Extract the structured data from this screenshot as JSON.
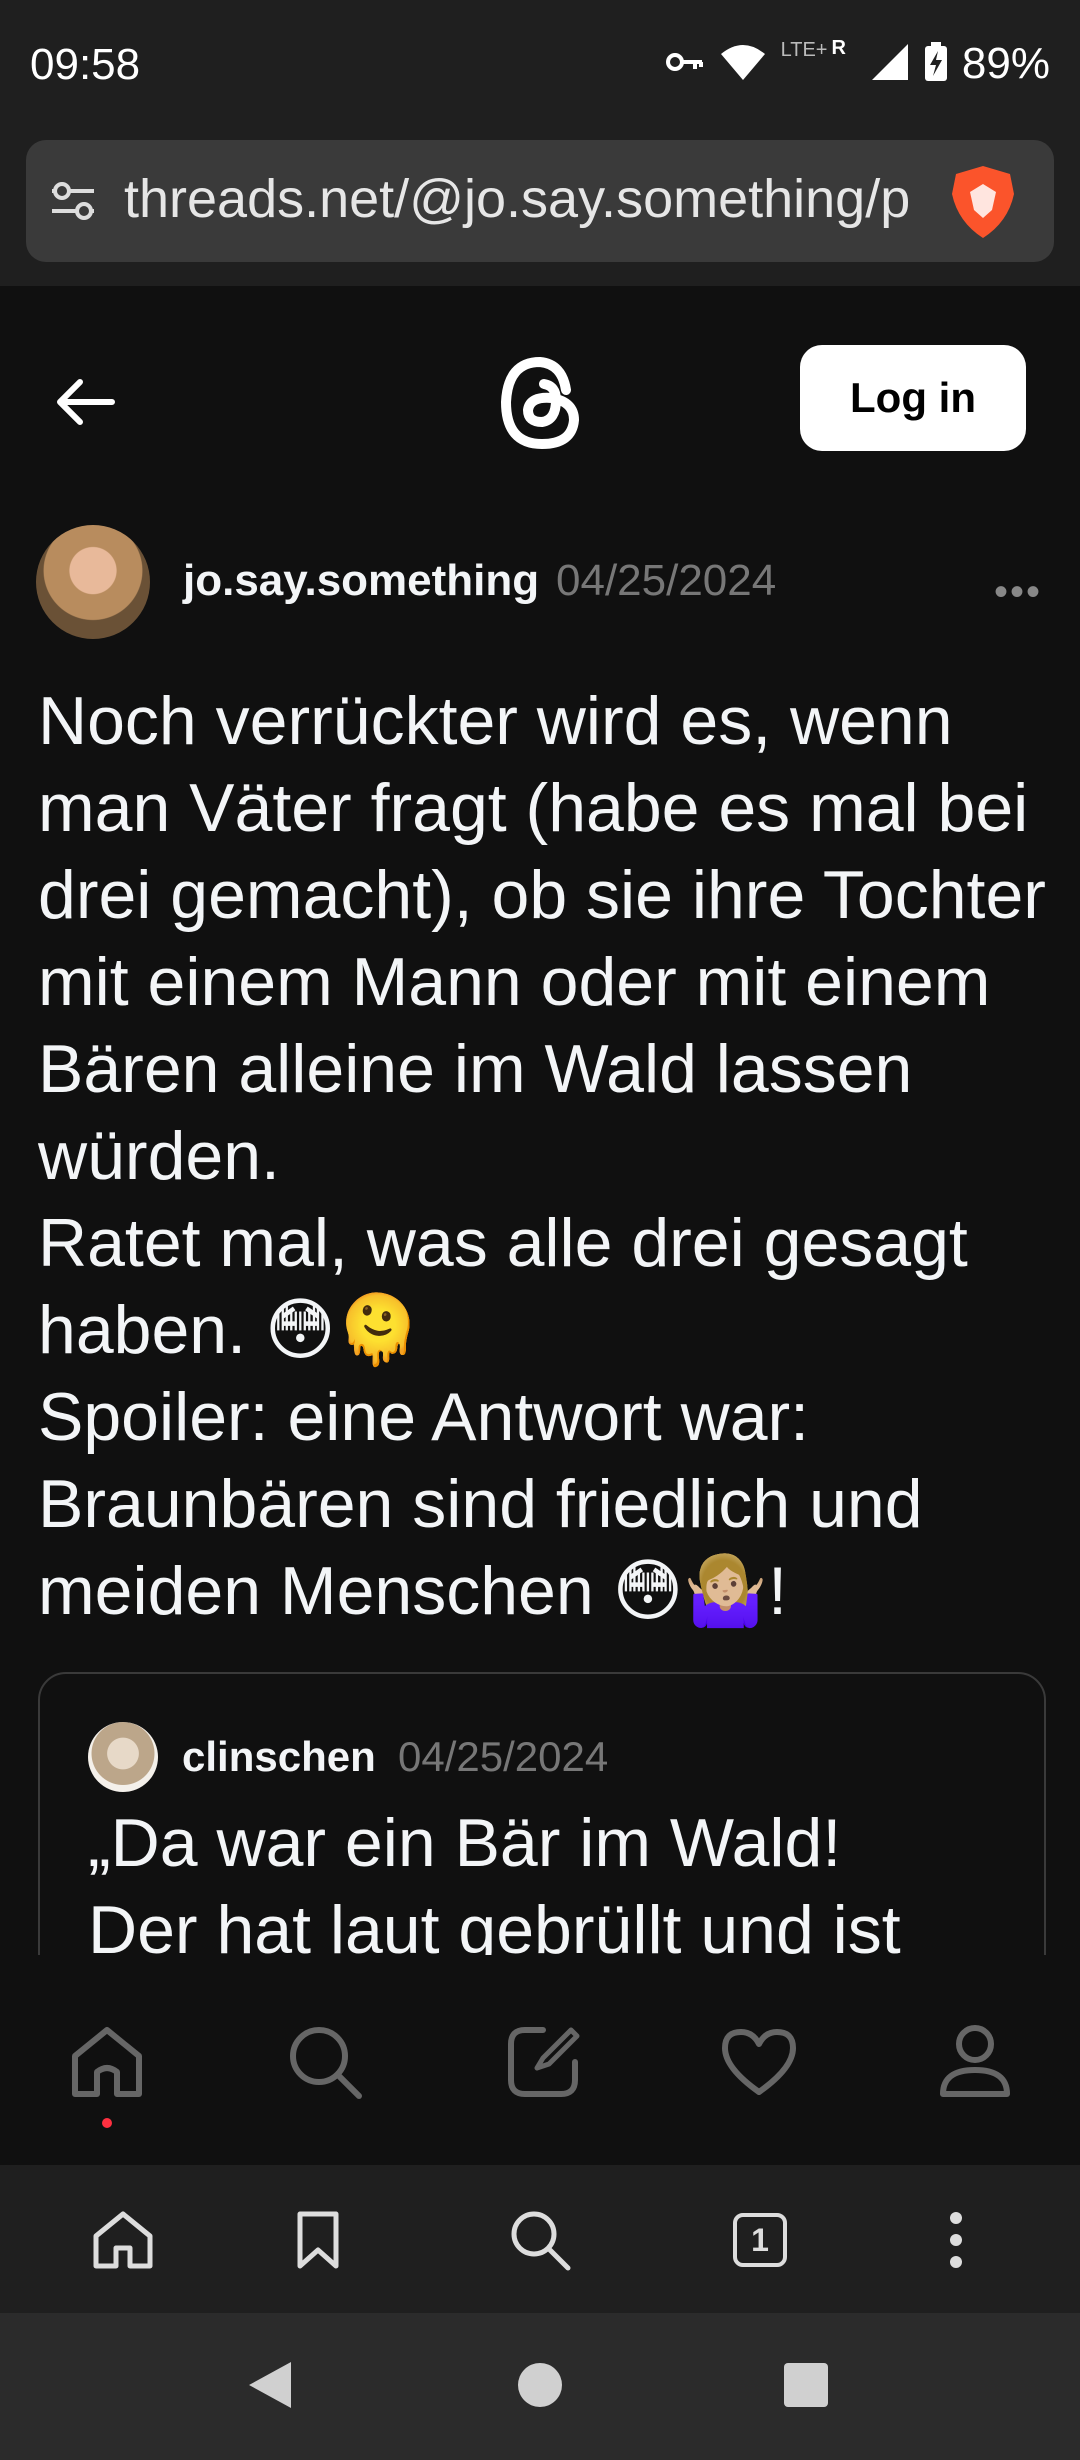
{
  "status_bar": {
    "time": "09:58",
    "battery": "89%",
    "network": "LTE+",
    "roaming": "R",
    "icons": [
      "key-icon",
      "wifi-icon",
      "signal-icon",
      "battery-charging-icon"
    ]
  },
  "browser": {
    "url": "threads.net/@jo.say.something/p",
    "icons": [
      "site-settings-icon",
      "brave-shield-icon"
    ],
    "toolbar": [
      "home-icon",
      "bookmark-icon",
      "search-icon",
      "tabs-icon",
      "menu-dots-icon"
    ],
    "tab_count": "1"
  },
  "app_header": {
    "login_label": "Log in",
    "icons": [
      "back-arrow-icon",
      "threads-logo-icon"
    ]
  },
  "post": {
    "username": "jo.say.something",
    "date": "04/25/2024",
    "more": "•••",
    "text": "Noch verrückter wird es, wenn man Väter fragt (habe es mal bei drei gemacht), ob sie ihre Tochter mit einem Mann oder mit einem Bären alleine im Wald lassen würden.\nRatet mal, was alle drei gesagt haben. 😳🫠\nSpoiler: eine Antwort war: Braunbären sind friedlich und meiden Menschen 😳🤷🏼‍♀️!"
  },
  "quoted_post": {
    "username": "clinschen",
    "date": "04/25/2024",
    "text": "„Da war ein Bär im Wald!\nDer hat laut gebrüllt und ist"
  },
  "bottom_nav": {
    "items": [
      "home-icon",
      "search-icon",
      "compose-icon",
      "heart-icon",
      "profile-icon"
    ],
    "accent": "#ff3040"
  },
  "android_nav": [
    "back-triangle-icon",
    "home-circle-icon",
    "recents-square-icon"
  ],
  "colors": {
    "background": "#101010",
    "chrome": "#1f1f1f",
    "text": "#f3f5f7",
    "muted": "#777777"
  }
}
